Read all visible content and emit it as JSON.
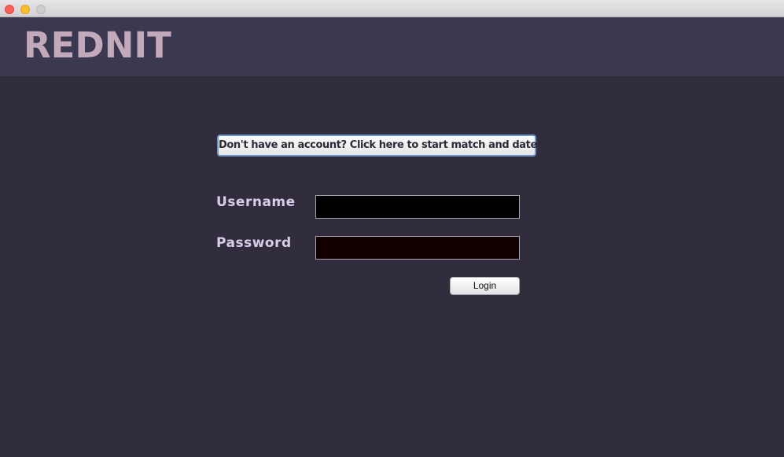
{
  "window": {
    "controls": [
      "close-icon",
      "minimize-icon",
      "maximize-icon"
    ]
  },
  "header": {
    "logo": "REDNIT"
  },
  "signup": {
    "label": "Don't have an account? Click here to start match and date!"
  },
  "form": {
    "username_label": "Username",
    "username_value": "",
    "password_label": "Password",
    "password_value": "",
    "login_label": "Login"
  },
  "colors": {
    "background": "#312d3c",
    "header": "#3b3852",
    "logo": "#c2aabb",
    "label": "#d8cdea"
  }
}
